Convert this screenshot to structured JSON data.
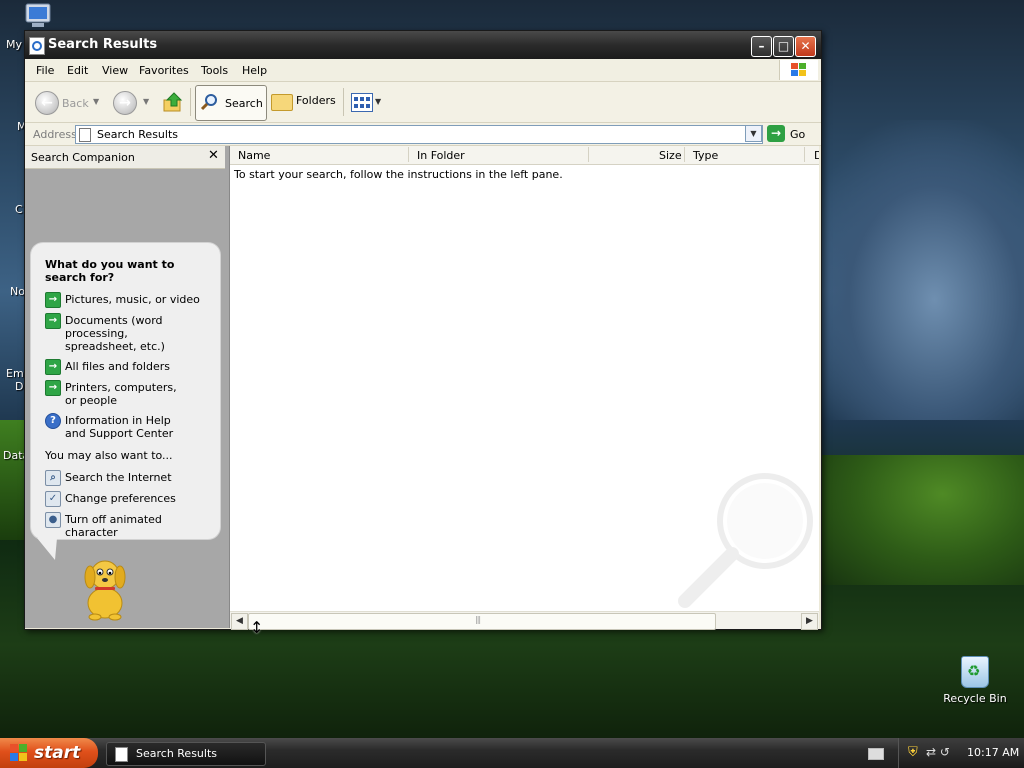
{
  "desktop": {
    "icon_labels_partial": [
      "My",
      "M",
      "C",
      "No",
      "Em",
      "D",
      "Data"
    ],
    "recycle_bin_label": "Recycle Bin"
  },
  "window": {
    "title": "Search Results",
    "menu": [
      "File",
      "Edit",
      "View",
      "Favorites",
      "Tools",
      "Help"
    ],
    "toolbar": {
      "back_label": "Back",
      "search_label": "Search",
      "folders_label": "Folders"
    },
    "address": {
      "label": "Address",
      "value": "Search Results",
      "go_label": "Go"
    },
    "search_companion": {
      "header": "Search Companion",
      "question": "What do you want to search for?",
      "options": [
        {
          "label": "Pictures, music, or video",
          "icon": "green-arrow-icon"
        },
        {
          "label": "Documents (word processing, spreadsheet, etc.)",
          "icon": "green-arrow-icon"
        },
        {
          "label": "All files and folders",
          "icon": "green-arrow-icon"
        },
        {
          "label": "Printers, computers, or people",
          "icon": "green-arrow-icon"
        },
        {
          "label": "Information in Help and Support Center",
          "icon": "help-icon"
        }
      ],
      "also_label": "You may also want to...",
      "also_options": [
        {
          "label": "Search the Internet",
          "icon": "search-internet-icon"
        },
        {
          "label": "Change preferences",
          "icon": "preferences-icon"
        },
        {
          "label": "Turn off animated character",
          "icon": "character-icon"
        }
      ]
    },
    "results": {
      "columns": [
        "Name",
        "In Folder",
        "Size",
        "Type",
        "D"
      ],
      "hint": "To start your search, follow the instructions in the left pane."
    }
  },
  "taskbar": {
    "start_label": "start",
    "task_button_label": "Search Results",
    "clock": "10:17 AM"
  }
}
